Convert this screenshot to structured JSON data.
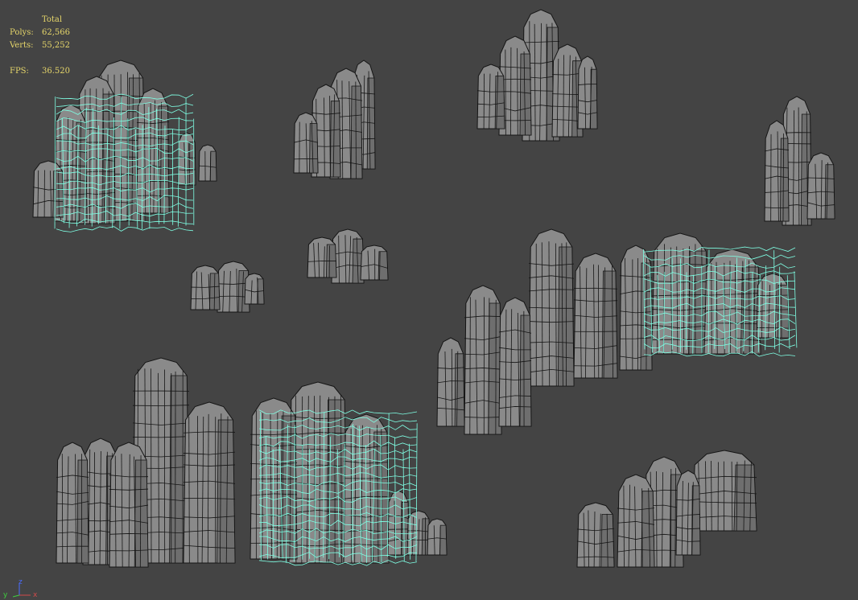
{
  "viewport": {
    "background_color": "#444444",
    "mesh_fill_color": "#8a8a8a",
    "wire_color": "#151515",
    "selection_wire_color": "#7fffe4"
  },
  "stats": {
    "header": "Total",
    "polys_label": "Polys:",
    "polys_value": "62,566",
    "verts_label": "Verts:",
    "verts_value": "55,252",
    "fps_label": "FPS:",
    "fps_value": "36.520",
    "text_color": "#e6d66a"
  },
  "axis_gizmo": {
    "z_label": "z",
    "y_label": "y",
    "x_label": "x",
    "z_color": "#4a6cff",
    "y_color": "#3ecf3e",
    "x_color": "#d24a4a"
  },
  "scene_objects": [
    {
      "name": "rock-cluster-top-left",
      "selected_part": true
    },
    {
      "name": "rock-spire-top-center-left",
      "selected_part": false
    },
    {
      "name": "rock-spire-top-center",
      "selected_part": false
    },
    {
      "name": "rock-spire-right",
      "selected_part": false
    },
    {
      "name": "rock-small-center-left",
      "selected_part": false
    },
    {
      "name": "rock-small-center",
      "selected_part": false
    },
    {
      "name": "rock-cluster-center-right",
      "selected_part": true
    },
    {
      "name": "rock-cluster-bottom-left",
      "selected_part": true
    },
    {
      "name": "rock-cluster-bottom-right",
      "selected_part": false
    }
  ]
}
